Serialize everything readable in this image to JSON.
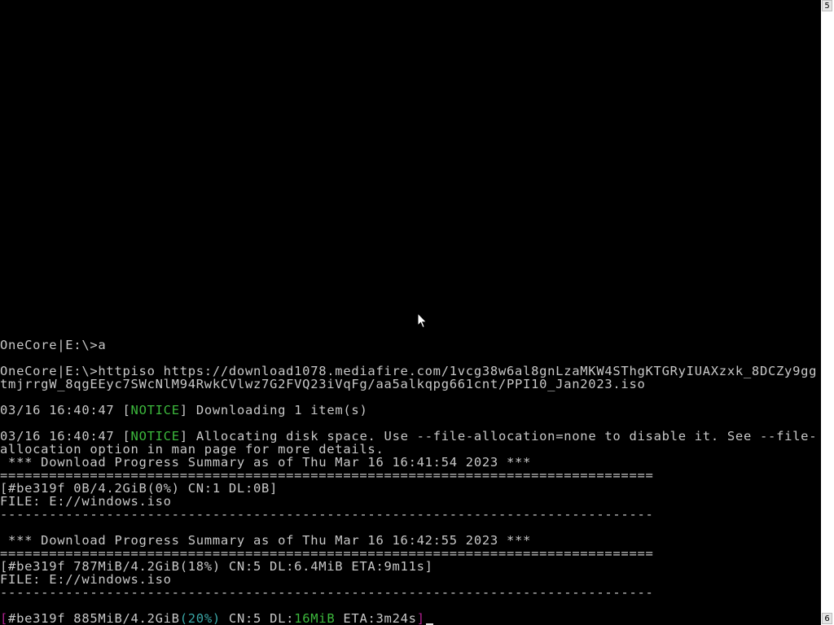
{
  "terminal": {
    "prompt_a": "OneCore|E:\\>a",
    "prompt_cmd_1": "OneCore|E:\\>httpiso https://download1078.mediafire.com/1vcg38w6al8gnLzaMKW4SThgKTGRyIUAXzxk_8DCZy9gg",
    "prompt_cmd_2": "tmjrrgW_8qgEEyc7SWcNlM94RwkCVlwz7G2FVQ23iVqFg/aa5alkqpg661cnt/PPI10_Jan2023.iso",
    "notice1": {
      "time": "03/16 16:40:47 ",
      "lbr": "[",
      "tag": "NOTICE",
      "rbr": "]",
      "msg": " Downloading 1 item(s)"
    },
    "notice2": {
      "time": "03/16 16:40:47 ",
      "lbr": "[",
      "tag": "NOTICE",
      "rbr": "]",
      "msg": " Allocating disk space. Use --file-allocation=none to disable it. See --file-",
      "msg2": "allocation option in man page for more details."
    },
    "summary1": {
      "header": " *** Download Progress Summary as of Thu Mar 16 16:41:54 2023 ***",
      "status": "[#be319f 0B/4.2GiB(0%) CN:1 DL:0B]",
      "file": "FILE: E://windows.iso"
    },
    "summary2": {
      "header": " *** Download Progress Summary as of Thu Mar 16 16:42:55 2023 ***",
      "status": "[#be319f 787MiB/4.2GiB(18%) CN:5 DL:6.4MiB ETA:9m11s]",
      "file": "FILE: E://windows.iso"
    },
    "live": {
      "lbr": "[",
      "gid": "#be319f 885MiB/4.2GiB",
      "pct": "(20%)",
      "cn": " CN:5 DL:",
      "speed": "16MiB",
      "eta": " ETA:3m24s",
      "rbr": "]"
    },
    "rule_double": "================================================================================",
    "rule_single": "--------------------------------------------------------------------------------"
  },
  "scrollbar": {
    "top_marker": "5",
    "bottom_marker": "6"
  },
  "colors": {
    "background": "#000000",
    "text": "#c8c8c8",
    "notice_green": "#3cb83c",
    "bracket_magenta": "#b0208f",
    "percent_cyan": "#3aa7a7"
  }
}
